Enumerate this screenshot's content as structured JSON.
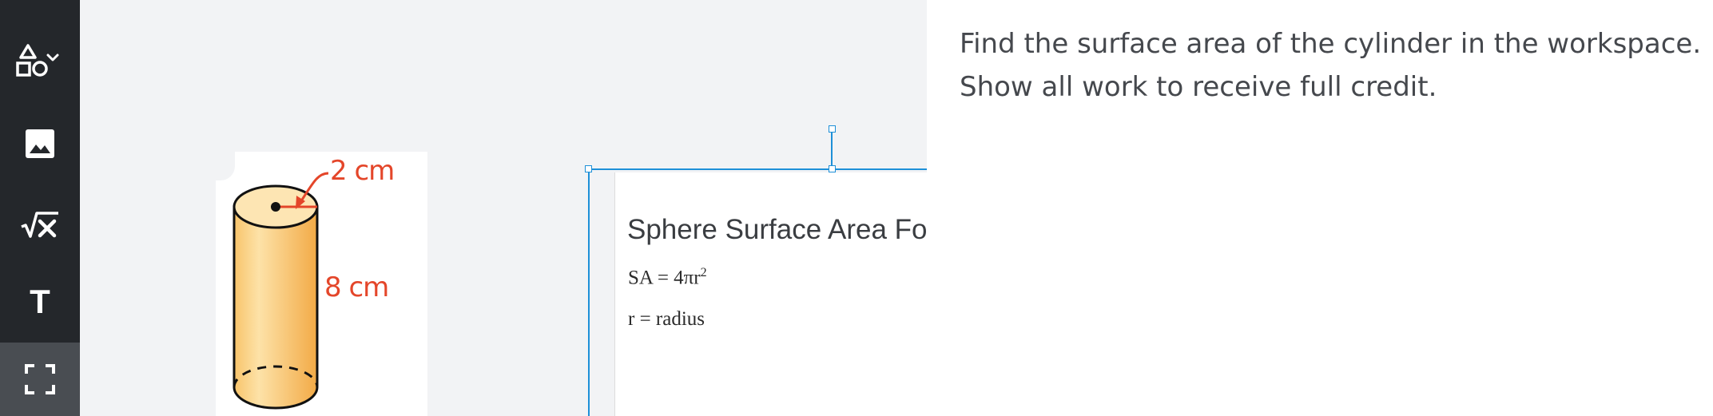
{
  "toolbar": {
    "tools": [
      {
        "icon": "shapes-icon",
        "has_dropdown": true,
        "active": false
      },
      {
        "icon": "image-icon",
        "active": false
      },
      {
        "icon": "equation-icon",
        "active": false
      },
      {
        "icon": "text-tool-icon",
        "label": "T",
        "active": false
      },
      {
        "icon": "fullscreen-icon",
        "active": true
      }
    ]
  },
  "workspace": {
    "cylinder_figure": {
      "radius_label": "2 cm",
      "height_label": "8 cm"
    },
    "formula_card": {
      "title": "Sphere Surface Area Formula",
      "formula": "SA = 4πr",
      "formula_exponent": "2",
      "definition": "r = radius"
    }
  },
  "question": {
    "line1": "Find the surface area of the cylinder in the workspace.",
    "line2": "Show all work to receive full credit."
  },
  "colors": {
    "sidebar": "#24272b",
    "sidebar_active": "#494d52",
    "selection": "#1e90d8",
    "label_red": "#e4462a",
    "cylinder_fill": "#f8c46a"
  }
}
